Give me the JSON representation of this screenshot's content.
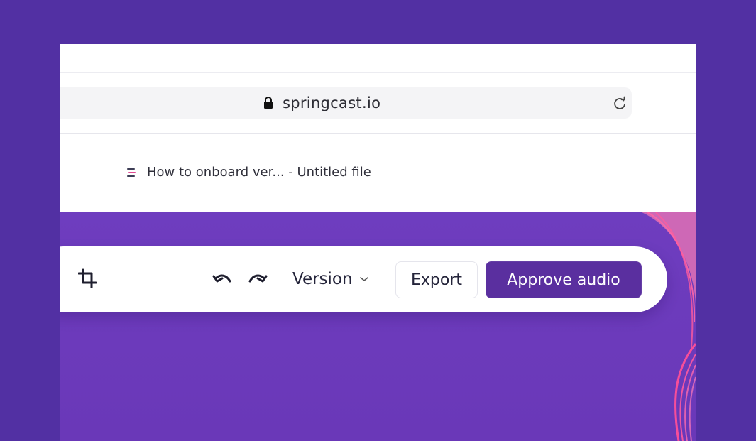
{
  "browser": {
    "url": "springcast.io",
    "lock_icon": "lock-icon",
    "reload_icon": "reload-icon"
  },
  "tab": {
    "favicon": "springcast-favicon",
    "title": "How to onboard ver... - Untitled file"
  },
  "toolbar": {
    "crop_icon": "crop-icon",
    "undo_icon": "undo-icon",
    "redo_icon": "redo-icon",
    "version_label": "Version",
    "version_icon": "chevron-down-icon",
    "export_label": "Export",
    "approve_label": "Approve audio"
  },
  "colors": {
    "background": "#5230a3",
    "canvas": "#6d3bbd",
    "primary_button": "#5a2f9f",
    "accent_wave": "#ff5fa2"
  }
}
